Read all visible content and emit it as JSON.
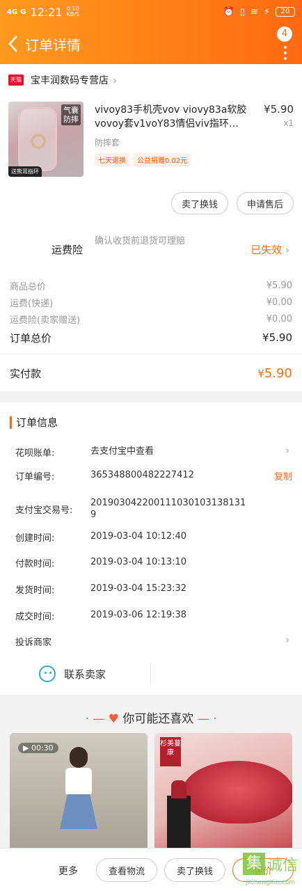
{
  "status_bar": {
    "signal1": "4G",
    "signal2": "G",
    "time": "12:21",
    "net_speed": "0.10",
    "net_unit": "KB/S",
    "battery": "20"
  },
  "nav": {
    "title": "订单详情",
    "badge_count": "4"
  },
  "store": {
    "badge": "天猫",
    "name": "宝丰润数码专营店"
  },
  "product": {
    "title": "vivoy83手机壳vov viovy83a软胶vovoy套v1voY83情侣viv指环…",
    "price": "¥5.90",
    "qty": "x1",
    "spec": "防摔套",
    "image_text_1": "气囊",
    "image_text_2": "防摔",
    "image_badge": "送熊耳指环",
    "tags": [
      "七天退换",
      "公益捐赠0.02元"
    ]
  },
  "product_actions": [
    "卖了换钱",
    "申请售后"
  ],
  "insurance": {
    "label": "运费险",
    "desc": "确认收货前退货可理赔",
    "status": "已失效"
  },
  "fees": {
    "rows": [
      {
        "label": "商品总价",
        "value": "¥5.90"
      },
      {
        "label": "运费(快递)",
        "value": "¥0.00"
      },
      {
        "label": "运费险(卖家赠送)",
        "value": "¥0.00"
      }
    ],
    "total_label": "订单总价",
    "total_value": "¥5.90",
    "paid_label": "实付款",
    "paid_currency": "¥",
    "paid_value": "5.90"
  },
  "order_info": {
    "title": "订单信息",
    "rows": [
      {
        "label": "花呗账单:",
        "value": "去支付宝中查看"
      },
      {
        "label": "订单编号:",
        "value": "365348800482227412",
        "action": "复制"
      },
      {
        "label": "支付宝交易号:",
        "value": "2019030422001110301031381319"
      },
      {
        "label": "创建时间:",
        "value": "2019-03-04 10:12:40"
      },
      {
        "label": "付款时间:",
        "value": "2019-03-04 10:13:10"
      },
      {
        "label": "发货时间:",
        "value": "2019-03-04 15:23:32"
      },
      {
        "label": "成交时间:",
        "value": "2019-03-06 12:19:38"
      }
    ],
    "complaint": "投诉商家"
  },
  "contact": {
    "label": "联系卖家"
  },
  "recommend": {
    "title": "你可能还喜欢",
    "video_time": "00:30",
    "stamp_text": "杉美蔓康"
  },
  "bottom_bar": {
    "more": "更多",
    "buttons": [
      "查看物流",
      "卖了换钱",
      "评价"
    ]
  },
  "watermark": {
    "char1": "集",
    "chars": "诚信",
    "url": "JiChengXin.com"
  },
  "colors": {
    "accent": "#ff6a10",
    "tmall_red": "#e8102b"
  }
}
